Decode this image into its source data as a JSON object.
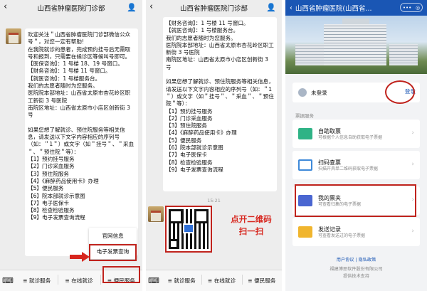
{
  "panel1": {
    "title": "山西省肿瘤医院门诊部",
    "message": "欢迎关注＂山西省肿瘤医院门诊部微信公众号＂，对您一定有帮助!\n在我院就诊的患者，完成预约挂号后无需取号和报到，只需要在候诊区等候叫号即可。\n【医保咨询】：1 号楼 18、19 号窗口。\n【财务咨询】：1 号楼 11 号窗口。\n【就医咨询】：1 号楼服务台。\n我们的志愿者随时为您服务。\n医院院本部地址：山西省太原市杏花岭区职工新街 3 号医院\n南院区地址：山西省太原市小店区创新街 3 号\n\n如果您想了解就诊、预住院服务等相关信息，请发送以下文字内容相应的序列号（如：＂1＂）或文字（如＂挂号＂、＂采血＂、＂预住院＂等）：\n【1】预约挂号服务\n【2】门诊采血服务\n【3】预住院服务\n【4】《麻醉药品使用卡》办理\n【5】便民服务\n【6】院本部就诊示意图\n【7】电子医保卡\n【8】检查检验服务\n【9】电子发票查询流程",
    "menu": [
      "官网信息",
      "电子发票查询"
    ],
    "bottom_tabs": [
      "就诊服务",
      "在线就诊",
      "便民服务"
    ]
  },
  "panel2": {
    "message": "【财务咨询】：1 号楼 11 号窗口。\n【就医咨询】：1 号楼服务台。\n我们的志愿者随时为您服务。\n医院院本部地址：山西省太原市杏花岭区职工新街 3 号医院\n南院区地址：山西省太原市小店区创新街 3 号\n\n如果您想了解就诊、预住院服务等相关信息，请发送以下文字内容相应的序列号（如：＂1＂）或文字（如＂挂号＂、＂采血＂、＂预住院＂等）：\n【1】预约挂号服务\n【2】门诊采血服务\n【3】预住院服务\n【4】《麻醉药品使用卡》办理\n【5】便民服务\n【6】院本部就诊示意图\n【7】电子医保卡\n【8】检查检验服务\n【9】电子发票查询流程",
    "timestamp": "15:21",
    "annotation": "点开二维码\n扫一扫",
    "bottom_tabs": [
      "就诊服务",
      "在线就诊",
      "便民服务"
    ]
  },
  "panel3": {
    "title": "山西省肿瘤医院(山西省...",
    "login_status": "未登录",
    "login_button": "登录",
    "section_label": "票据服务",
    "services": [
      {
        "name": "自助取票",
        "desc": "可根据个人信息自助获取电子票据",
        "color": "#2fb386"
      },
      {
        "name": "扫码查票",
        "desc": "扫描开具单二维码获取电子票据",
        "color": "#3f8ad9"
      },
      {
        "name": "我的票夹",
        "desc": "可查看归集的电子票据",
        "color": "#4a66d1"
      },
      {
        "name": "发送记录",
        "desc": "可查看发送过的电子票据",
        "color": "#f0b52e"
      }
    ],
    "footer_links": "用户协议 | 隐私政策",
    "footer_company": "福建博思软件股份有限公司",
    "footer_support": "提供技术支持"
  }
}
